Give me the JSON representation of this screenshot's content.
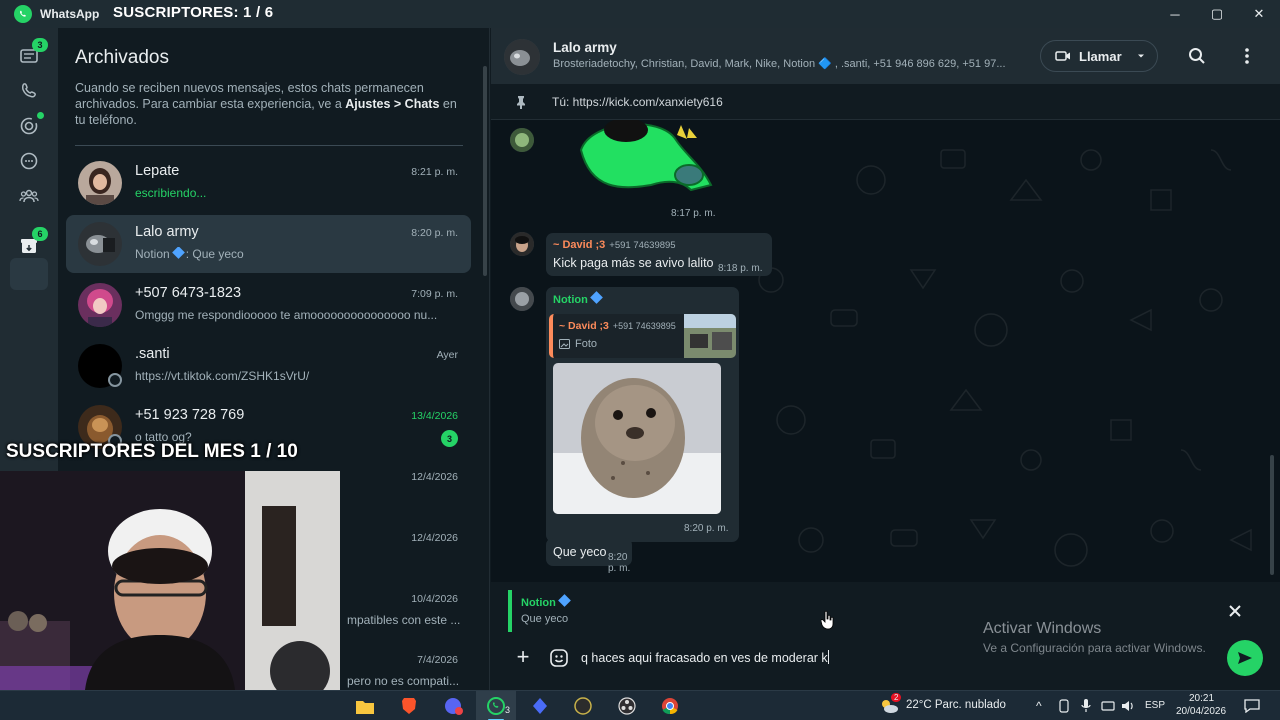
{
  "titlebar": {
    "app_name": "WhatsApp",
    "overlay_subs": "SUSCRIPTORES: 1 / 6",
    "minimize": "─",
    "maximize": "▢",
    "close": "✕"
  },
  "rail": {
    "chats_badge": "3",
    "archived_badge": "6"
  },
  "archived": {
    "title": "Archivados",
    "info_prefix": "Cuando se reciben nuevos mensajes, estos chats permanecen archivados. Para cambiar esta experiencia, ve a ",
    "info_bold": "Ajustes > Chats",
    "info_suffix": " en tu teléfono."
  },
  "chats": [
    {
      "name": "Lepate",
      "time": "8:21 p. m.",
      "last": "escribiendo..."
    },
    {
      "name": "Lalo army",
      "time": "8:20 p. m.",
      "last_sender": "Notion",
      "last": ": Que yeco"
    },
    {
      "name": "+507 6473-1823",
      "time": "7:09 p. m.",
      "last": "Omggg me respondiooooo te amooooooooooooooo nu..."
    },
    {
      "name": ".santi",
      "time": "Ayer",
      "last": "https://vt.tiktok.com/ZSHK1sVrU/"
    },
    {
      "name": "+51 923 728 769",
      "time": "13/4/2026",
      "last": "o tatto og?",
      "unread": "3"
    },
    {
      "name": "",
      "time": "12/4/2026",
      "last": ""
    },
    {
      "name": "",
      "time": "12/4/2026",
      "last": ""
    },
    {
      "name": "",
      "time": "10/4/2026",
      "last": "mpatibles con este ..."
    },
    {
      "name": "",
      "time": "7/4/2026",
      "last": "pero no es compati..."
    }
  ],
  "overlay_mes": "SUSCRIPTORES DEL MES 1 / 10",
  "header": {
    "name": "Lalo army",
    "members": "Brosteriadetochy, Christian, David, Mark, Nike, Notion 🔷 , .santi, +51 946 896 629, +51 97...",
    "call_label": "Llamar"
  },
  "pinned": {
    "text": "Tú: https://kick.com/xanxiety616"
  },
  "messages": {
    "sticker_time": "8:17 p. m.",
    "david": {
      "sender": "~ David ;3",
      "phone": "+591 74639895",
      "text": "Kick paga más se avivo lalito",
      "time": "8:18 p. m."
    },
    "notion": {
      "sender": "Notion",
      "quote_sender": "~ David ;3",
      "quote_phone": "+591 74639895",
      "quote_type": "Foto",
      "photo_time": "8:20 p. m.",
      "text": "Que yeco",
      "time": "8:20 p. m."
    }
  },
  "reply": {
    "sender": "Notion",
    "text": "Que yeco"
  },
  "composer": {
    "plus": "+",
    "text": "q haces aqui fracasado en ves de moderar k"
  },
  "windows": {
    "title": "Activar Windows",
    "subtitle": "Ve a Configuración para activar Windows."
  },
  "taskbar": {
    "whatsapp_badge": "3",
    "weather_badge": "2",
    "weather": "22°C  Parc. nublado",
    "lang": "ESP",
    "time": "20:21",
    "date": "20/04/2026"
  },
  "colors": {
    "accent": "#25d366",
    "bg": "#111b21",
    "panel": "#202c33",
    "david": "#fd8b5b",
    "notion": "#25d366"
  }
}
